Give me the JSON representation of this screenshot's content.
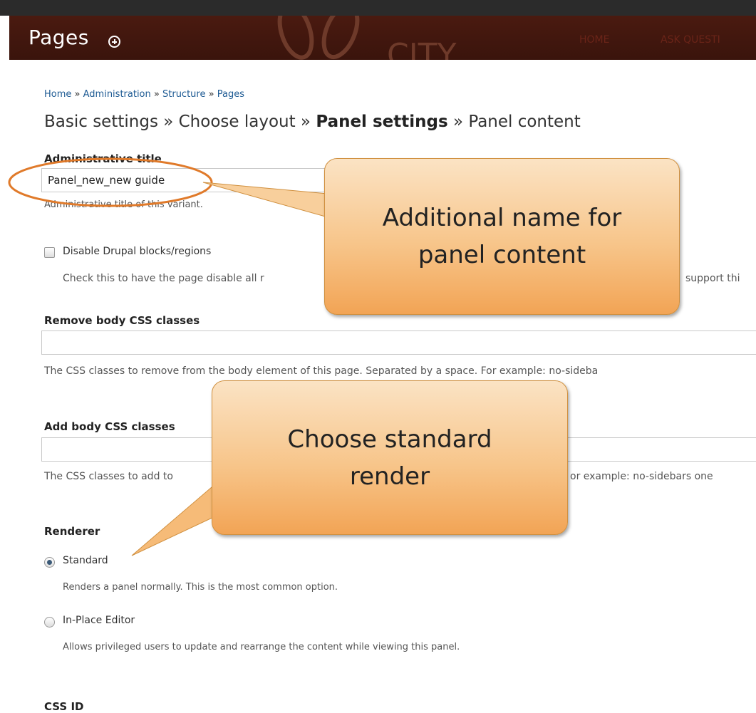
{
  "header": {
    "title": "Pages",
    "nav": [
      "HOME",
      "ASK QUESTI"
    ],
    "logo_text": "CITY"
  },
  "breadcrumb": [
    "Home",
    "Administration",
    "Structure",
    "Pages"
  ],
  "wizard": {
    "steps": [
      "Basic settings",
      "Choose layout",
      "Panel settings",
      "Panel content"
    ],
    "current": "Panel settings"
  },
  "admin_title": {
    "label": "Administrative title",
    "value": "Panel_new_new guide",
    "description": "Administrative title of this variant."
  },
  "disable_blocks": {
    "label": "Disable Drupal blocks/regions",
    "checked": false,
    "description_left": "Check this to have the page disable all r",
    "description_right": "support thi"
  },
  "remove_css": {
    "label": "Remove body CSS classes",
    "value": "",
    "description": "The CSS classes to remove from the body element of this page. Separated by a space. For example: no-sideba"
  },
  "add_css": {
    "label": "Add body CSS classes",
    "value": "",
    "description_left": "The CSS classes to add to",
    "description_right": "or example: no-sidebars one"
  },
  "renderer": {
    "label": "Renderer",
    "options": [
      {
        "label": "Standard",
        "selected": true,
        "description": "Renders a panel normally. This is the most common option."
      },
      {
        "label": "In-Place Editor",
        "selected": false,
        "description": "Allows privileged users to update and rearrange the content while viewing this panel."
      }
    ]
  },
  "css_id": {
    "label": "CSS ID"
  },
  "callouts": {
    "first": [
      "Additional name for",
      "panel content"
    ],
    "second": [
      "Choose standard",
      "render"
    ]
  },
  "colors": {
    "header_bg": "#4a1a10",
    "link": "#1d5a93",
    "callout_border": "#d0903f",
    "highlight_ring": "#e07a2a"
  }
}
